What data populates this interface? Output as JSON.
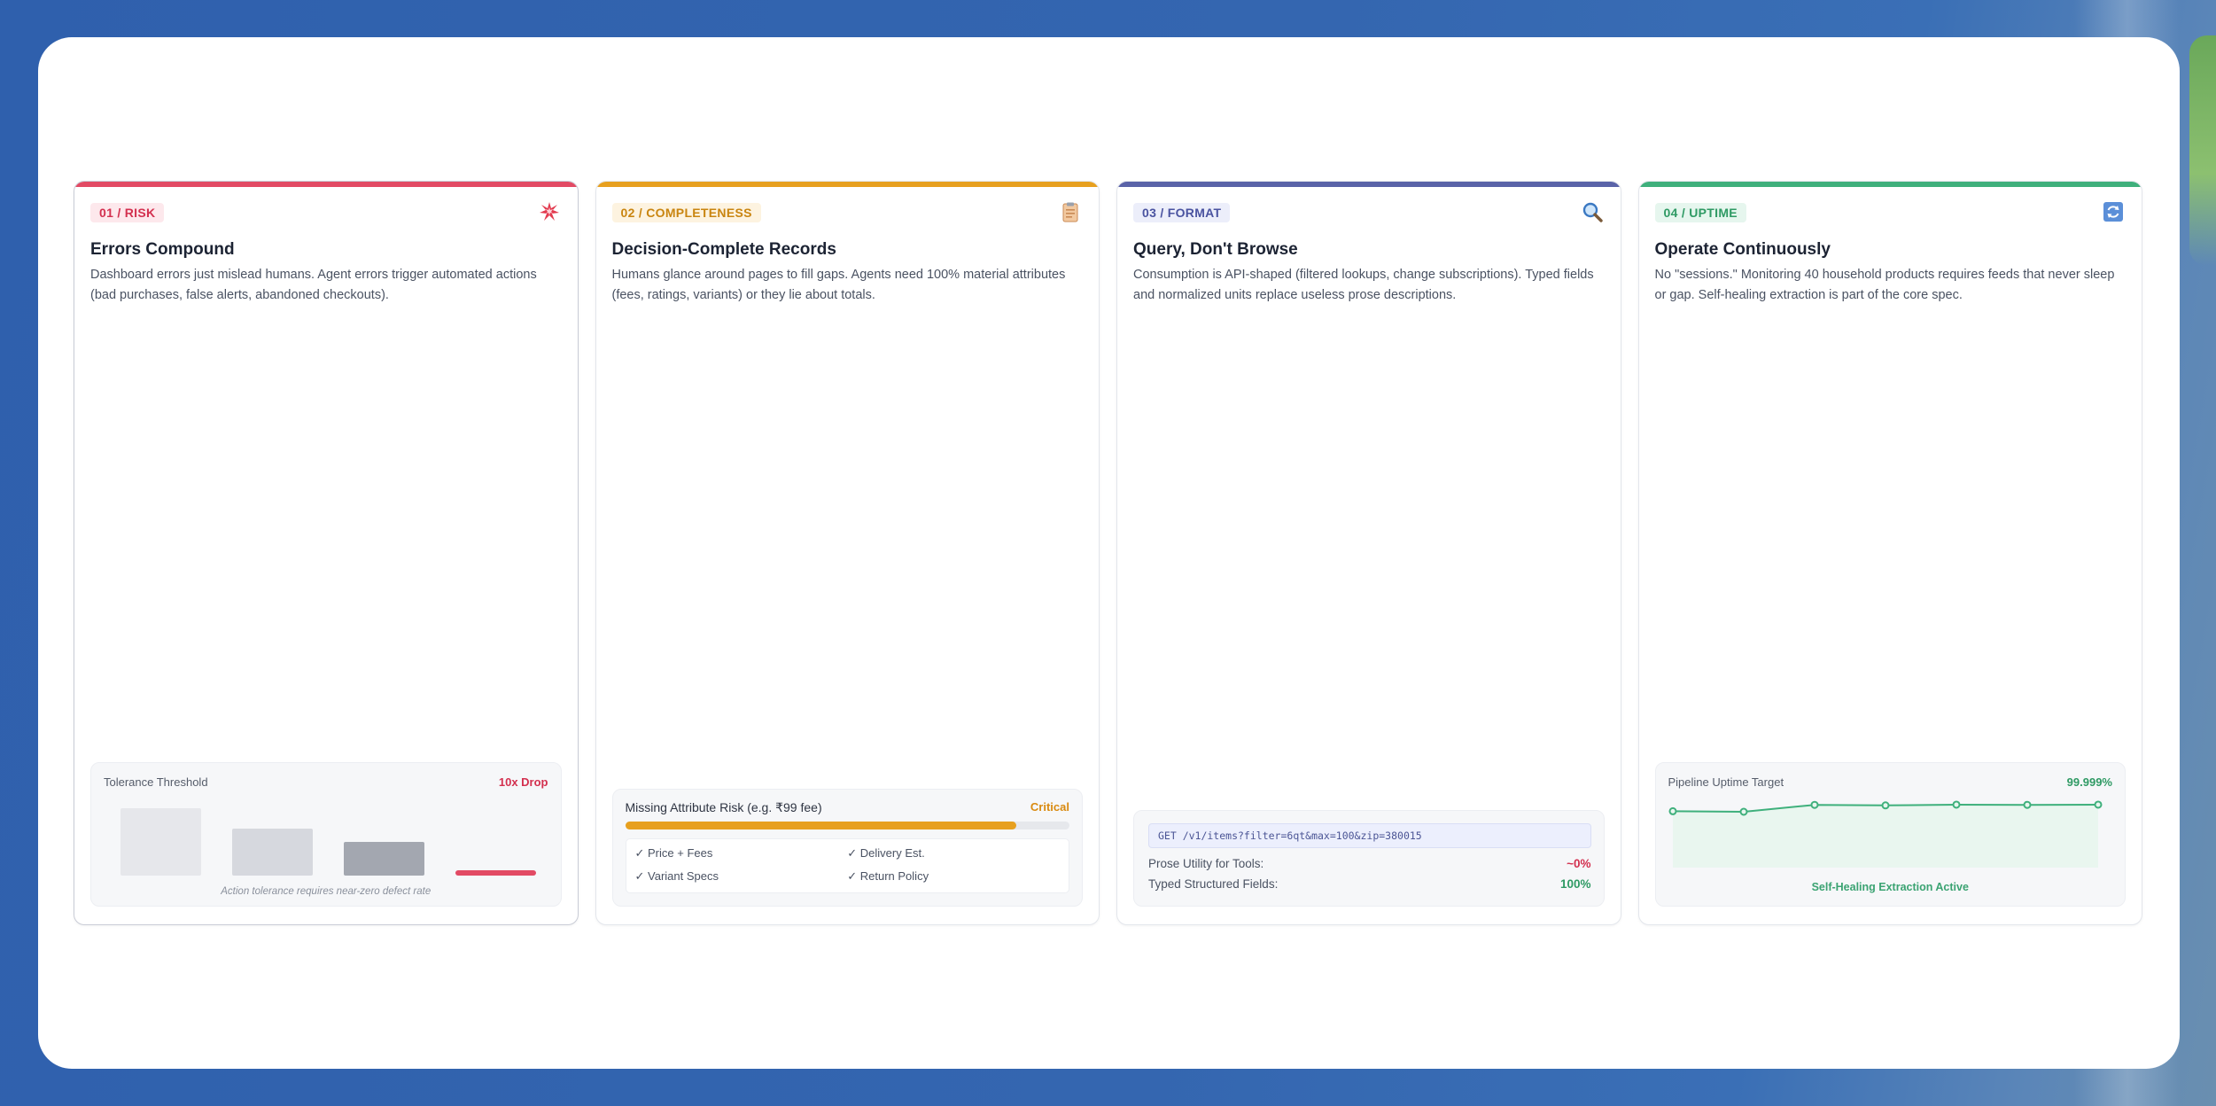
{
  "colors": {
    "risk": "#e24a64",
    "completeness": "#e7a01f",
    "format": "#5a63a8",
    "uptime": "#3fb07c"
  },
  "cards": [
    {
      "tag": "01 / RISK",
      "icon": "collision-icon",
      "title": "Errors Compound",
      "description": "Dashboard errors just mislead humans. Agent errors trigger automated actions (bad purchases, false alerts, abandoned checkouts).",
      "widget": {
        "label": "Tolerance Threshold",
        "value": "10x Drop",
        "bar_levels": [
          1.0,
          0.7,
          0.5,
          0.08
        ],
        "caption": "Action tolerance requires near-zero defect rate"
      }
    },
    {
      "tag": "02 / COMPLETENESS",
      "icon": "clipboard-icon",
      "title": "Decision-Complete Records",
      "description": "Humans glance around pages to fill gaps. Agents need 100% material attributes (fees, ratings, variants) or they lie about totals.",
      "widget": {
        "label": "Missing Attribute Risk (e.g. ₹99 fee)",
        "value": "Critical",
        "progress": 0.88,
        "checks": [
          "✓ Price + Fees",
          "✓ Delivery Est.",
          "✓ Variant Specs",
          "✓ Return Policy"
        ]
      }
    },
    {
      "tag": "03 / FORMAT",
      "icon": "magnifier-icon",
      "title": "Query, Don't Browse",
      "description": "Consumption is API-shaped (filtered lookups, change subscriptions). Typed fields and normalized units replace useless prose descriptions.",
      "widget": {
        "code": "GET /v1/items?filter=6qt&max=100&zip=380015",
        "rows": [
          {
            "label": "Prose Utility for Tools:",
            "value": "~0%"
          },
          {
            "label": "Typed Structured Fields:",
            "value": "100%"
          }
        ]
      }
    },
    {
      "tag": "04 / UPTIME",
      "icon": "refresh-icon",
      "title": "Operate Continuously",
      "description": "No \"sessions.\" Monitoring 40 household products requires feeds that never sleep or gap. Self-healing extraction is part of the core spec.",
      "widget": {
        "label": "Pipeline Uptime Target",
        "value": "99.999%",
        "points": [
          0.3,
          0.25,
          0.9,
          0.85,
          0.92,
          0.9,
          0.92
        ],
        "caption": "Self-Healing Extraction Active"
      }
    }
  ]
}
